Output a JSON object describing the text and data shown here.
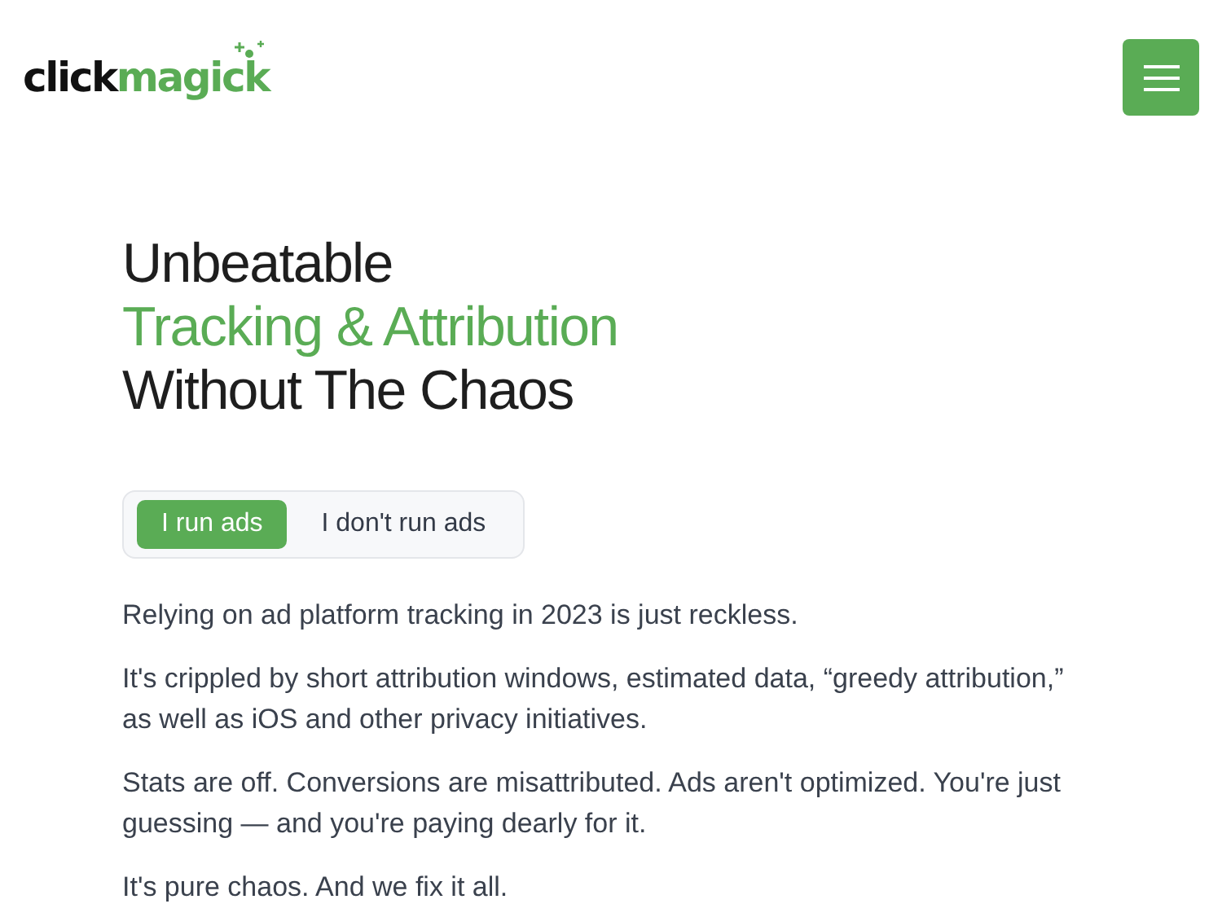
{
  "logo": {
    "part_1": "click",
    "part_2": "magick"
  },
  "headline": [
    "Unbeatable",
    "Tracking & Attribution",
    "Without The Chaos"
  ],
  "toggle": [
    {
      "label": "I run ads",
      "selected": true
    },
    {
      "label": "I don't run ads",
      "selected": false
    }
  ],
  "paragraphs": [
    "Relying on ad platform tracking in 2023 is just reckless.",
    "It's crippled by short attribution windows, estimated data, “greedy attribution,” as well as iOS and other privacy initiatives.",
    "Stats are off. Conversions are misattributed. Ads aren't optimized. You're just guessing — and you're paying dearly for it.",
    "It's pure chaos. And we fix it all."
  ]
}
